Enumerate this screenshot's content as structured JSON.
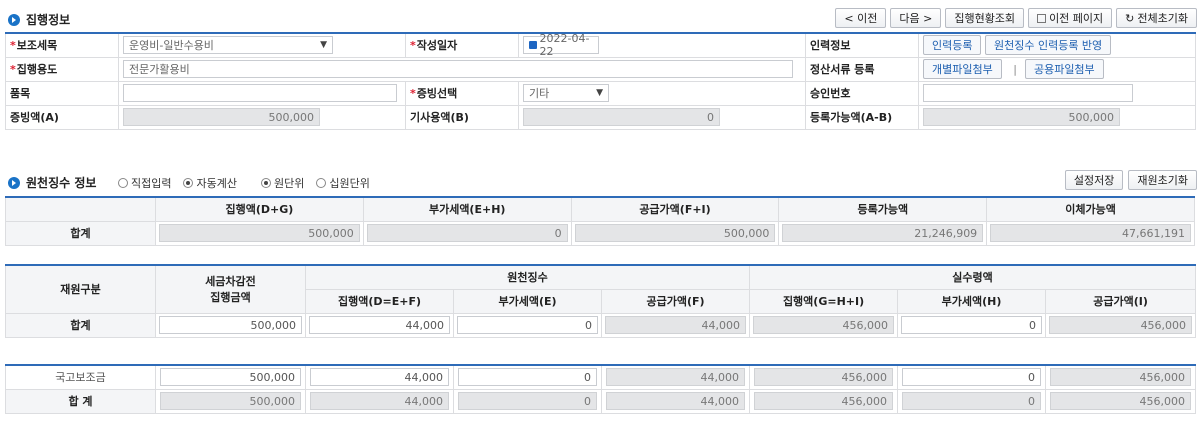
{
  "section1": {
    "title": "집행정보"
  },
  "toolbar": {
    "prev": "< 이전",
    "next": "다음 >",
    "status": "집행현황조회",
    "prev_page": "이전 페이지",
    "reset_all": "전체초기화"
  },
  "form": {
    "subsidy_item_label": "보조세목",
    "subsidy_item_value": "운영비-일반수용비",
    "write_date_label": "작성일자",
    "write_date_value": "2022-04-22",
    "input_info_label": "인력정보",
    "input_reg_btn": "인력등록",
    "withhold_reg_btn": "원천징수 인력등록 반영",
    "usage_label": "집행용도",
    "usage_value": "전문가활용비",
    "settle_docs_label": "정산서류 등록",
    "indiv_attach_btn": "개별파일첨부",
    "sep": "|",
    "common_attach_btn": "공용파일첨부",
    "item_label": "품목",
    "proof_type_label": "증빙선택",
    "proof_type_value": "기타",
    "approval_label": "승인번호",
    "proof_amt_label": "증빙액(A)",
    "proof_amt_value": "500,000",
    "used_amt_label": "기사용액(B)",
    "used_amt_value": "0",
    "reg_avail_label": "등록가능액(A-B)",
    "reg_avail_value": "500,000"
  },
  "section2": {
    "title": "원천징수 정보",
    "radio_direct": "직접입력",
    "radio_auto": "자동계산",
    "radio_won": "원단위",
    "radio_ten": "십원단위",
    "save_settings": "설정저장",
    "reset_finance": "재원초기화"
  },
  "summary": {
    "headers": [
      "집행액(D+G)",
      "부가세액(E+H)",
      "공급가액(F+I)",
      "등록가능액",
      "이체가능액"
    ],
    "row_label": "합계",
    "values": [
      "500,000",
      "0",
      "500,000",
      "21,246,909",
      "47,661,191"
    ]
  },
  "detail": {
    "col_finance": "재원구분",
    "col_tax_deduct_1": "세금차감전",
    "col_tax_deduct_2": "집행금액",
    "grp_withhold": "원천징수",
    "grp_actual": "실수령액",
    "sub_headers": [
      "집행액(D=E+F)",
      "부가세액(E)",
      "공급가액(F)",
      "집행액(G=H+I)",
      "부가세액(H)",
      "공급가액(I)"
    ],
    "total_label": "합계",
    "total_values": [
      "500,000",
      "44,000",
      "0",
      "44,000",
      "456,000",
      "0",
      "456,000"
    ]
  },
  "rows": [
    {
      "label": "국고보조금",
      "values": [
        "500,000",
        "44,000",
        "0",
        "44,000",
        "456,000",
        "0",
        "456,000"
      ]
    },
    {
      "label": "합 계",
      "values": [
        "500,000",
        "44,000",
        "0",
        "44,000",
        "456,000",
        "0",
        "456,000"
      ]
    }
  ]
}
